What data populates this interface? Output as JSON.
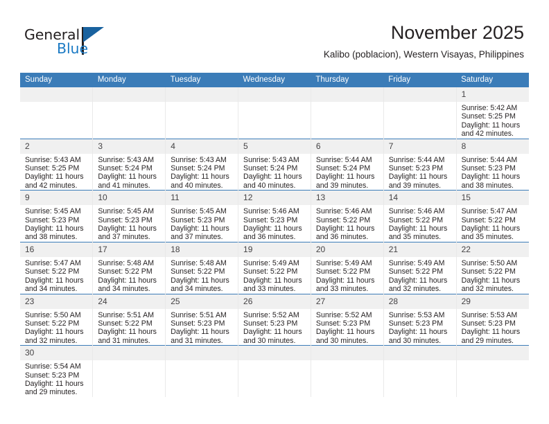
{
  "brand": {
    "name_part1": "General",
    "name_part2": "Blue"
  },
  "header": {
    "month_title": "November 2025",
    "location": "Kalibo (poblacion), Western Visayas, Philippines"
  },
  "colors": {
    "header_blue": "#3b7cb8",
    "brand_blue": "#1b7ac4",
    "daynum_band": "#f0f0f0"
  },
  "weekday_headers": [
    "Sunday",
    "Monday",
    "Tuesday",
    "Wednesday",
    "Thursday",
    "Friday",
    "Saturday"
  ],
  "weeks": [
    [
      {
        "day": "",
        "empty": true
      },
      {
        "day": "",
        "empty": true
      },
      {
        "day": "",
        "empty": true
      },
      {
        "day": "",
        "empty": true
      },
      {
        "day": "",
        "empty": true
      },
      {
        "day": "",
        "empty": true
      },
      {
        "day": "1",
        "sunrise": "Sunrise: 5:42 AM",
        "sunset": "Sunset: 5:25 PM",
        "daylight": "Daylight: 11 hours and 42 minutes."
      }
    ],
    [
      {
        "day": "2",
        "sunrise": "Sunrise: 5:43 AM",
        "sunset": "Sunset: 5:25 PM",
        "daylight": "Daylight: 11 hours and 42 minutes."
      },
      {
        "day": "3",
        "sunrise": "Sunrise: 5:43 AM",
        "sunset": "Sunset: 5:24 PM",
        "daylight": "Daylight: 11 hours and 41 minutes."
      },
      {
        "day": "4",
        "sunrise": "Sunrise: 5:43 AM",
        "sunset": "Sunset: 5:24 PM",
        "daylight": "Daylight: 11 hours and 40 minutes."
      },
      {
        "day": "5",
        "sunrise": "Sunrise: 5:43 AM",
        "sunset": "Sunset: 5:24 PM",
        "daylight": "Daylight: 11 hours and 40 minutes."
      },
      {
        "day": "6",
        "sunrise": "Sunrise: 5:44 AM",
        "sunset": "Sunset: 5:24 PM",
        "daylight": "Daylight: 11 hours and 39 minutes."
      },
      {
        "day": "7",
        "sunrise": "Sunrise: 5:44 AM",
        "sunset": "Sunset: 5:23 PM",
        "daylight": "Daylight: 11 hours and 39 minutes."
      },
      {
        "day": "8",
        "sunrise": "Sunrise: 5:44 AM",
        "sunset": "Sunset: 5:23 PM",
        "daylight": "Daylight: 11 hours and 38 minutes."
      }
    ],
    [
      {
        "day": "9",
        "sunrise": "Sunrise: 5:45 AM",
        "sunset": "Sunset: 5:23 PM",
        "daylight": "Daylight: 11 hours and 38 minutes."
      },
      {
        "day": "10",
        "sunrise": "Sunrise: 5:45 AM",
        "sunset": "Sunset: 5:23 PM",
        "daylight": "Daylight: 11 hours and 37 minutes."
      },
      {
        "day": "11",
        "sunrise": "Sunrise: 5:45 AM",
        "sunset": "Sunset: 5:23 PM",
        "daylight": "Daylight: 11 hours and 37 minutes."
      },
      {
        "day": "12",
        "sunrise": "Sunrise: 5:46 AM",
        "sunset": "Sunset: 5:23 PM",
        "daylight": "Daylight: 11 hours and 36 minutes."
      },
      {
        "day": "13",
        "sunrise": "Sunrise: 5:46 AM",
        "sunset": "Sunset: 5:22 PM",
        "daylight": "Daylight: 11 hours and 36 minutes."
      },
      {
        "day": "14",
        "sunrise": "Sunrise: 5:46 AM",
        "sunset": "Sunset: 5:22 PM",
        "daylight": "Daylight: 11 hours and 35 minutes."
      },
      {
        "day": "15",
        "sunrise": "Sunrise: 5:47 AM",
        "sunset": "Sunset: 5:22 PM",
        "daylight": "Daylight: 11 hours and 35 minutes."
      }
    ],
    [
      {
        "day": "16",
        "sunrise": "Sunrise: 5:47 AM",
        "sunset": "Sunset: 5:22 PM",
        "daylight": "Daylight: 11 hours and 34 minutes."
      },
      {
        "day": "17",
        "sunrise": "Sunrise: 5:48 AM",
        "sunset": "Sunset: 5:22 PM",
        "daylight": "Daylight: 11 hours and 34 minutes."
      },
      {
        "day": "18",
        "sunrise": "Sunrise: 5:48 AM",
        "sunset": "Sunset: 5:22 PM",
        "daylight": "Daylight: 11 hours and 34 minutes."
      },
      {
        "day": "19",
        "sunrise": "Sunrise: 5:49 AM",
        "sunset": "Sunset: 5:22 PM",
        "daylight": "Daylight: 11 hours and 33 minutes."
      },
      {
        "day": "20",
        "sunrise": "Sunrise: 5:49 AM",
        "sunset": "Sunset: 5:22 PM",
        "daylight": "Daylight: 11 hours and 33 minutes."
      },
      {
        "day": "21",
        "sunrise": "Sunrise: 5:49 AM",
        "sunset": "Sunset: 5:22 PM",
        "daylight": "Daylight: 11 hours and 32 minutes."
      },
      {
        "day": "22",
        "sunrise": "Sunrise: 5:50 AM",
        "sunset": "Sunset: 5:22 PM",
        "daylight": "Daylight: 11 hours and 32 minutes."
      }
    ],
    [
      {
        "day": "23",
        "sunrise": "Sunrise: 5:50 AM",
        "sunset": "Sunset: 5:22 PM",
        "daylight": "Daylight: 11 hours and 32 minutes."
      },
      {
        "day": "24",
        "sunrise": "Sunrise: 5:51 AM",
        "sunset": "Sunset: 5:22 PM",
        "daylight": "Daylight: 11 hours and 31 minutes."
      },
      {
        "day": "25",
        "sunrise": "Sunrise: 5:51 AM",
        "sunset": "Sunset: 5:23 PM",
        "daylight": "Daylight: 11 hours and 31 minutes."
      },
      {
        "day": "26",
        "sunrise": "Sunrise: 5:52 AM",
        "sunset": "Sunset: 5:23 PM",
        "daylight": "Daylight: 11 hours and 30 minutes."
      },
      {
        "day": "27",
        "sunrise": "Sunrise: 5:52 AM",
        "sunset": "Sunset: 5:23 PM",
        "daylight": "Daylight: 11 hours and 30 minutes."
      },
      {
        "day": "28",
        "sunrise": "Sunrise: 5:53 AM",
        "sunset": "Sunset: 5:23 PM",
        "daylight": "Daylight: 11 hours and 30 minutes."
      },
      {
        "day": "29",
        "sunrise": "Sunrise: 5:53 AM",
        "sunset": "Sunset: 5:23 PM",
        "daylight": "Daylight: 11 hours and 29 minutes."
      }
    ],
    [
      {
        "day": "30",
        "sunrise": "Sunrise: 5:54 AM",
        "sunset": "Sunset: 5:23 PM",
        "daylight": "Daylight: 11 hours and 29 minutes."
      },
      {
        "day": "",
        "empty": true
      },
      {
        "day": "",
        "empty": true
      },
      {
        "day": "",
        "empty": true
      },
      {
        "day": "",
        "empty": true
      },
      {
        "day": "",
        "empty": true
      },
      {
        "day": "",
        "empty": true
      }
    ]
  ]
}
